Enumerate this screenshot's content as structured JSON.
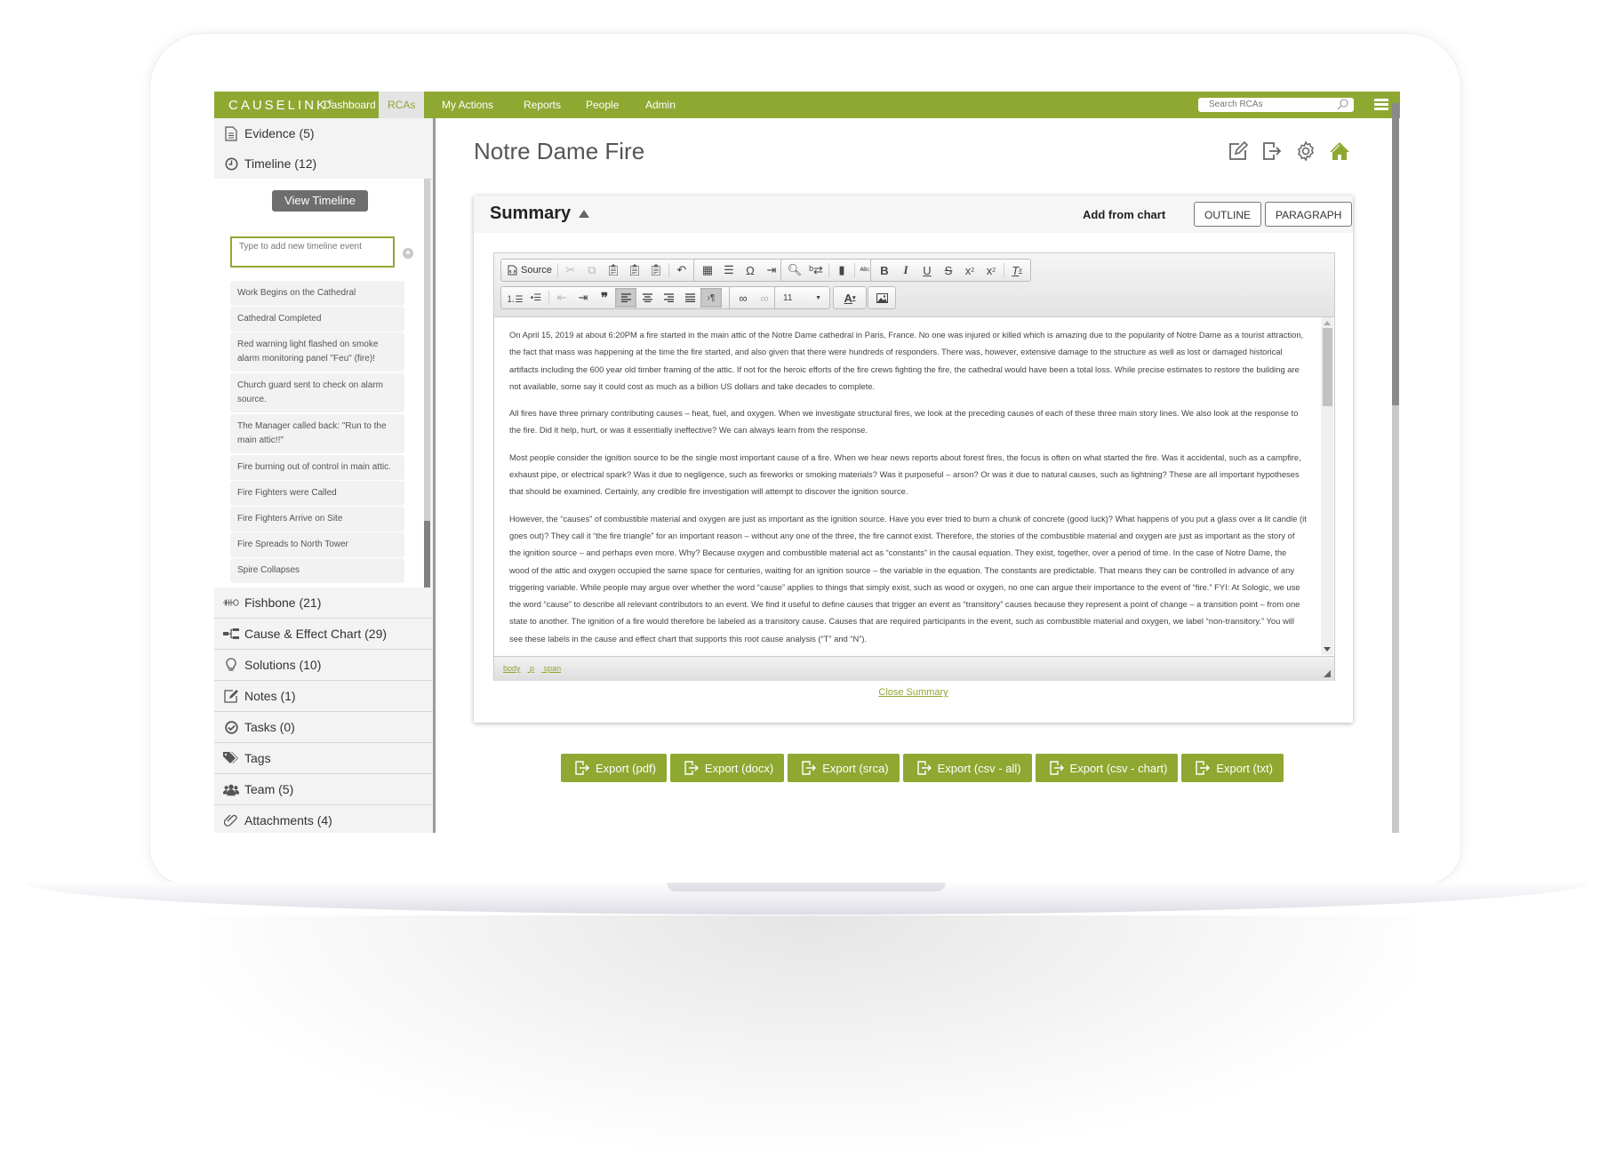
{
  "nav": {
    "logo": "CAUSELINK",
    "items": [
      {
        "label": "Dashboard",
        "active": false
      },
      {
        "label": "RCAs",
        "active": true
      },
      {
        "label": "My Actions",
        "active": false
      },
      {
        "label": "Reports",
        "active": false
      },
      {
        "label": "People",
        "active": false
      },
      {
        "label": "Admin",
        "active": false
      }
    ],
    "search_placeholder": "Search RCAs"
  },
  "sidebar": {
    "top_items": [
      {
        "label": "Evidence (5)",
        "icon": "document-icon"
      },
      {
        "label": "Timeline (12)",
        "icon": "clock-icon"
      }
    ],
    "timeline": {
      "view_button": "View Timeline",
      "input_placeholder": "Type to add new timeline event",
      "events": [
        "Work Begins on the Cathedral",
        "Cathedral Completed",
        "Red warning light flashed on smoke alarm monitoring panel \"Feu\" (fire)!",
        "Church guard sent to check on alarm source.",
        "The Manager called back: \"Run to the main attic!!\"",
        "Fire burning out of control in main attic.",
        "Fire Fighters were Called",
        "Fire Fighters Arrive on Site",
        "Fire Spreads to North Tower",
        "Spire Collapses"
      ]
    },
    "bottom_items": [
      {
        "label": "Fishbone (21)",
        "icon": "fishbone-icon"
      },
      {
        "label": "Cause & Effect Chart (29)",
        "icon": "chart-icon"
      },
      {
        "label": "Solutions (10)",
        "icon": "lightbulb-icon"
      },
      {
        "label": "Notes (1)",
        "icon": "edit-icon"
      },
      {
        "label": "Tasks (0)",
        "icon": "check-circle-icon"
      },
      {
        "label": "Tags",
        "icon": "tag-icon"
      },
      {
        "label": "Team (5)",
        "icon": "team-icon"
      },
      {
        "label": "Attachments (4)",
        "icon": "paperclip-icon"
      }
    ]
  },
  "main": {
    "title": "Notre Dame Fire",
    "header_icons": [
      "edit-icon",
      "export-icon",
      "gear-icon",
      "home-icon"
    ],
    "summary": {
      "title": "Summary",
      "add_from_chart": "Add from chart",
      "outline_button": "OUTLINE",
      "paragraph_button": "PARAGRAPH",
      "toolbar": {
        "source_label": "Source",
        "font_size": "11"
      },
      "paragraphs": [
        "On April 15, 2019 at about 6:20PM a fire started in the main attic of the Notre Dame cathedral in Paris, France.  No one was injured or killed which is amazing due to the popularity of Notre Dame as a tourist attraction, the fact that mass was happening at the time the fire started, and also given that there were hundreds of responders.  There was, however, extensive damage to the structure as well as lost or damaged historical artifacts including the 600 year old timber framing of the attic.  If not for the heroic efforts of the fire crews fighting the fire, the cathedral would have been a total loss.  While precise estimates to restore the building are not available, some say it could cost as much as a billion US dollars and take decades to complete.",
        "All fires have three primary contributing causes – heat, fuel, and oxygen.  When we investigate structural fires, we look at the preceding causes of each of these three main story lines.  We also look at the response to the fire.  Did it help, hurt, or was it essentially ineffective?  We can always learn from the response.",
        "Most people consider the ignition source to be the single most important cause of a fire.  When we hear news reports about forest fires, the focus is often on what started the fire.  Was it accidental, such as a campfire, exhaust pipe, or electrical spark?  Was it due to negligence, such as fireworks or smoking materials?  Was it purposeful – arson?  Or was it due to natural causes, such as lightning?  These are all important hypotheses that should be examined.  Certainly, any credible fire investigation will attempt to discover the ignition source.",
        "However, the “causes” of combustible material and oxygen are just as important as the ignition source.  Have you ever tried to burn a chunk of concrete (good luck)?  What happens of you put a glass over a lit candle (it goes out)?  They call it “the fire triangle” for an important reason – without any one of the three, the fire cannot exist.  Therefore, the stories of the combustible material and oxygen are just as important as the story of the ignition source – and perhaps even more.  Why?  Because oxygen and combustible material act as “constants” in the causal equation.  They exist, together, over a period of time.  In the case of Notre Dame, the wood of the attic and oxygen occupied the same space for centuries, waiting for an ignition source – the variable in the equation.  The constants are predictable.  That means they can be controlled in advance of any triggering variable.  While people may argue over whether the word “cause” applies to things that simply exist, such as wood or oxygen, no one can argue their importance to the event of “fire.”  FYI:  At Sologic, we use the word “cause” to describe all relevant contributors to an event.  We find it useful to define causes that trigger an event as “transitory” causes because they represent a point of change – a transition point – from one state to another.  The ignition of a fire would therefore be labeled as a transitory cause.  Causes that are required participants in the event, such as combustible material and oxygen, we label “non-transitory.”  You will see these labels in the cause and effect chart that supports this root cause analysis (“T” and “N”)."
      ],
      "element_path": [
        "body",
        "p",
        "span"
      ],
      "close_link": "Close Summary"
    },
    "exports": [
      "Export (pdf)",
      "Export (docx)",
      "Export (srca)",
      "Export (csv - all)",
      "Export (csv - chart)",
      "Export (txt)"
    ]
  },
  "colors": {
    "brand_green": "#8fa832",
    "nav_active_bg": "#e4e4e4",
    "sidebar_bg": "#f3f3f3",
    "button_gray": "#6e6e6e"
  }
}
